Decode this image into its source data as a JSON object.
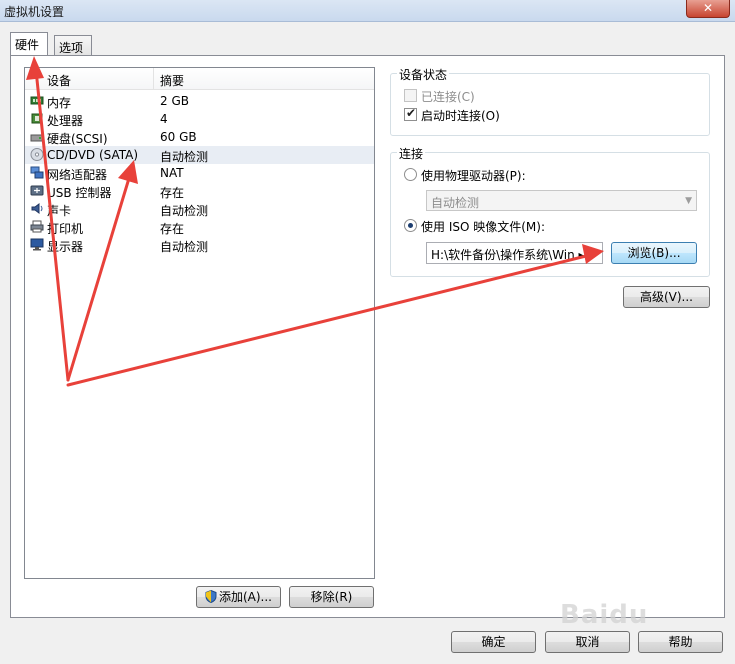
{
  "window": {
    "title": "虚拟机设置",
    "close_glyph": "✕"
  },
  "tabs": [
    {
      "label": "硬件",
      "active": true
    },
    {
      "label": "选项",
      "active": false
    }
  ],
  "device_list": {
    "columns": [
      "设备",
      "摘要"
    ],
    "rows": [
      {
        "name": "内存",
        "summary": "2 GB",
        "icon": "memory-icon"
      },
      {
        "name": "处理器",
        "summary": "4",
        "icon": "processor-icon"
      },
      {
        "name": "硬盘(SCSI)",
        "summary": "60 GB",
        "icon": "hard-disk-icon"
      },
      {
        "name": "CD/DVD (SATA)",
        "summary": "自动检测",
        "icon": "cd-dvd-icon",
        "selected": true
      },
      {
        "name": "网络适配器",
        "summary": "NAT",
        "icon": "network-adapter-icon"
      },
      {
        "name": "USB 控制器",
        "summary": "存在",
        "icon": "usb-icon"
      },
      {
        "name": "声卡",
        "summary": "自动检测",
        "icon": "sound-card-icon"
      },
      {
        "name": "打印机",
        "summary": "存在",
        "icon": "printer-icon"
      },
      {
        "name": "显示器",
        "summary": "自动检测",
        "icon": "display-icon"
      }
    ]
  },
  "device_status": {
    "title": "设备状态",
    "connected": {
      "label": "已连接(C)",
      "checked": false,
      "enabled": false
    },
    "connect_at_power_on": {
      "label": "启动时连接(O)",
      "checked": true,
      "enabled": true
    }
  },
  "connection": {
    "title": "连接",
    "use_physical": {
      "label": "使用物理驱动器(P):",
      "selected": false
    },
    "physical_drive_value": "自动检测",
    "use_iso": {
      "label": "使用 ISO 映像文件(M):",
      "selected": true
    },
    "iso_path": "H:\\软件备份\\操作系统\\Win ▸",
    "browse_label": "浏览(B)..."
  },
  "advanced_label": "高级(V)...",
  "add_label": "添加(A)...",
  "remove_label": "移除(R)",
  "footer": {
    "ok_label": "确定",
    "cancel_label": "取消",
    "help_label": "帮助"
  },
  "colors": {
    "annotation_arrow": "#e8413a"
  }
}
